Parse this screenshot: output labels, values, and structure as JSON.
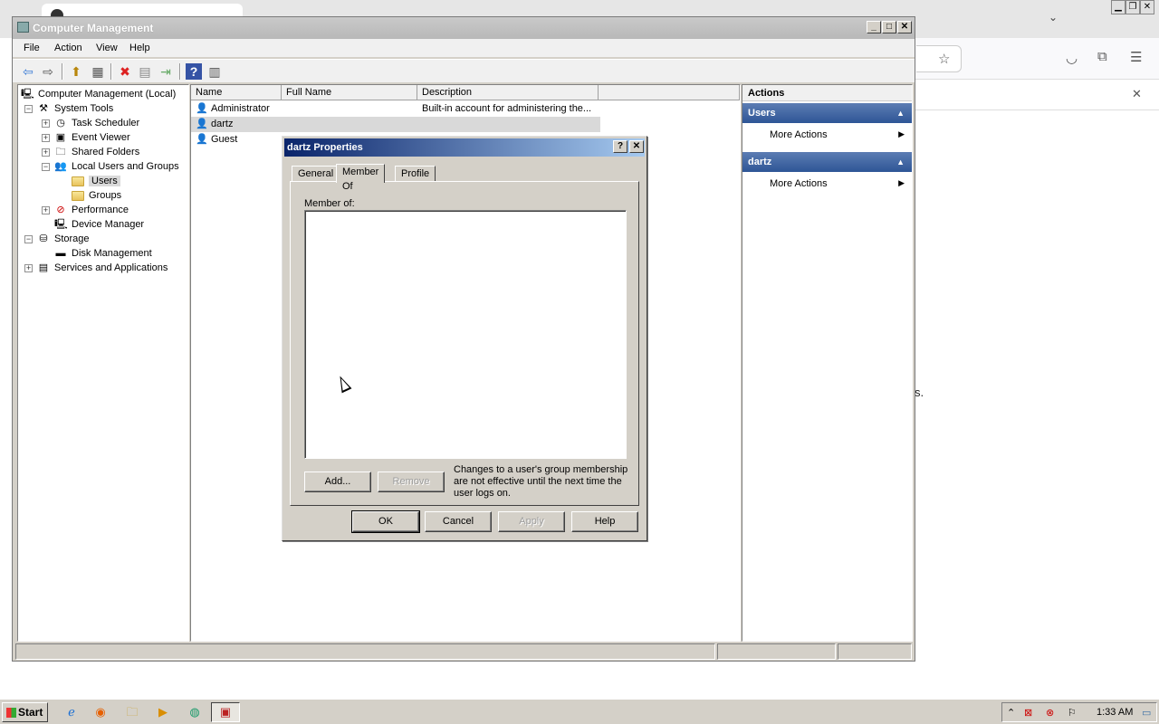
{
  "mmc": {
    "title": "Computer Management",
    "menu": [
      "File",
      "Action",
      "View",
      "Help"
    ]
  },
  "tree": {
    "root": "Computer Management (Local)",
    "system_tools": "System Tools",
    "task_scheduler": "Task Scheduler",
    "event_viewer": "Event Viewer",
    "shared_folders": "Shared Folders",
    "local_users_groups": "Local Users and Groups",
    "users": "Users",
    "groups": "Groups",
    "performance": "Performance",
    "device_manager": "Device Manager",
    "storage": "Storage",
    "disk_management": "Disk Management",
    "services_apps": "Services and Applications",
    "expand_plus": "+",
    "expand_minus": "−"
  },
  "list": {
    "columns": [
      "Name",
      "Full Name",
      "Description"
    ],
    "rows": [
      {
        "name": "Administrator",
        "full_name": "",
        "description": "Built-in account for administering the..."
      },
      {
        "name": "dartz",
        "full_name": "",
        "description": ""
      },
      {
        "name": "Guest",
        "full_name": "",
        "description": ""
      }
    ]
  },
  "actions": {
    "title": "Actions",
    "section1": "Users",
    "section1_item": "More Actions",
    "section2": "dartz",
    "section2_item": "More Actions"
  },
  "dialog": {
    "title": "dartz Properties",
    "help_btn": "?",
    "close_btn": "✕",
    "tabs": [
      "General",
      "Member Of",
      "Profile"
    ],
    "active_tab": "Member Of",
    "member_of_label": "Member of:",
    "add_button": "Add...",
    "remove_button": "Remove",
    "note": "Changes to a user's group membership are not effective until the next time the user logs on.",
    "ok": "OK",
    "cancel": "Cancel",
    "apply": "Apply",
    "help": "Help"
  },
  "taskbar": {
    "start": "Start",
    "clock": "1:33 AM"
  },
  "browser": {
    "text_fragment": "s."
  },
  "colors": {
    "title_gradient_start": "#0a246a",
    "title_gradient_end": "#a6caf0",
    "action_section": "#2e5596",
    "selection": "#d9d9d9"
  }
}
